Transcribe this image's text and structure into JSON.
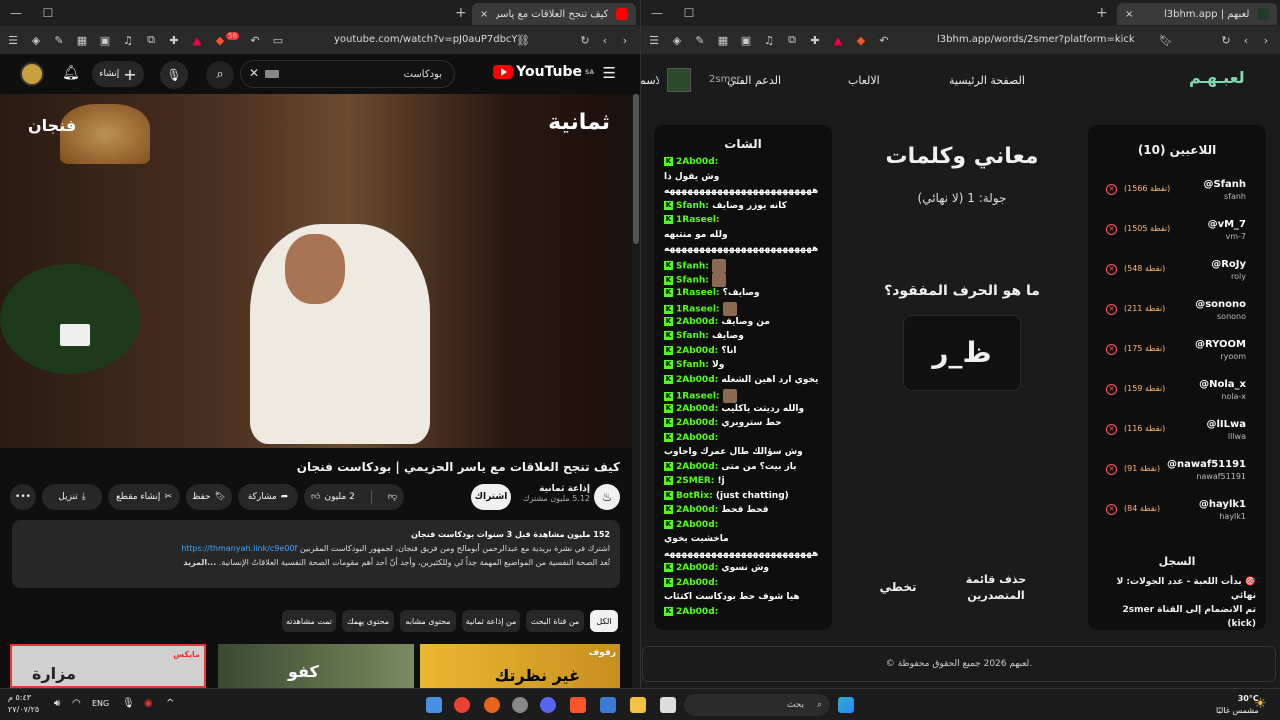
{
  "left_window": {
    "tab": {
      "title": "كيف تنجح العلاقات مع ياسر الحز",
      "close": "×",
      "new": "+"
    },
    "win_controls": {
      "min": "—",
      "max": "☐"
    },
    "url": "youtube.com/watch?v=pJ0auP7dbcY",
    "badge": "56",
    "youtube": {
      "logo": "YouTube",
      "country": "SA",
      "search_value": "بودكاست",
      "create_label": "إنشاء",
      "video_overlay_left": "فنجان",
      "video_overlay_right": "ثمانية",
      "title": "كيف تنجح العلاقات مع ياسر الحزيمي | بودكاست فنجان",
      "channel": "إذاعة ثمانية",
      "subscribers": "5.12 مليون مشترك",
      "subscribe_label": "اشتراك",
      "likes": "2 مليون",
      "share": "مشاركة",
      "save": "حفظ",
      "clip": "إنشاء مقطع",
      "download": "تنزيل",
      "desc_line1": "152 مليون مشاهدة  قبل 3 سنوات  بودكاست فنجان",
      "desc_line2": "اشترك في نشرة بريدية مع عبدالرحمن أبومالح ومن فريق فنجان، لجمهور البودكاست المقربين",
      "desc_link": "https://thmanyah.link/c9e00f",
      "desc_line3": "تُعد الصحة النفسية من المواضيع المهمة جداً لي وللكثيرين، وأجد أنّ أحد أهم مقومات الصحة النفسية العلاقاتُ الإنسانية.",
      "desc_more": "...المزيد",
      "chips": [
        "الكل",
        "من قناة البحث",
        "من إذاعة ثمانية",
        "محتوى مشابه",
        "محتوى يهمك",
        "تمت مشاهدته"
      ],
      "thumb_labels": [
        "رفوف",
        "غير نظرتك",
        "كفو",
        "مزارة",
        "مايكس"
      ]
    }
  },
  "right_window": {
    "tab": {
      "title": "لعبهم | l3bhm.app",
      "close": "×",
      "new": "+"
    },
    "url": "l3bhm.app/words/2smer?platform=kick",
    "site": {
      "logo": "لعبـهـم",
      "nav": [
        "الصفحة الرئيسية",
        "الالعاب",
        "الدعم الفني",
        "الاسم"
      ],
      "user": "2smer",
      "players_title": "اللاعبين (10)",
      "players": [
        {
          "name": "@Sfanh",
          "sub": "sfanh",
          "points": "(1566 نقطة)"
        },
        {
          "name": "@vM_7",
          "sub": "vm-7",
          "points": "(1505 نقطة)"
        },
        {
          "name": "@RoJy",
          "sub": "roly",
          "points": "(548 نقطة)"
        },
        {
          "name": "@sonono",
          "sub": "sonono",
          "points": "(211 نقطة)"
        },
        {
          "name": "@RYOOM",
          "sub": "ryoom",
          "points": "(175 نقطة)"
        },
        {
          "name": "@Nola_x",
          "sub": "nola-x",
          "points": "(159 نقطة)"
        },
        {
          "name": "@lILwa",
          "sub": "lllwa",
          "points": "(116 نقطة)"
        },
        {
          "name": "@nawaf51191",
          "sub": "nawaf51191",
          "points": "(91 نقطة)"
        },
        {
          "name": "@haylk1",
          "sub": "haylk1",
          "points": "(84 نقطة)"
        }
      ],
      "game_title": "معاني وكلمات",
      "round": "جولة: 1 (لا نهائي)",
      "question": "ما هو الحرف المفقود؟",
      "puzzle": "ظ_ر",
      "skip_label": "تخطي",
      "clear_label": "حذف قائمة المتصدرين",
      "log_title": "السجل",
      "log_lines": [
        "🎯 بدأت اللعبة - عدد الجولات: لا نهائي",
        "تم الانضمام إلى القناة 2smer (kick)"
      ],
      "chat_title": "الشات",
      "chat": [
        {
          "user": "2Ab00d:",
          "text": ""
        },
        {
          "user": "",
          "text": "وش يقول ذا"
        },
        {
          "user": "",
          "text": "هههههههههههههههههههههههههه"
        },
        {
          "user": "Sfanh:",
          "text": "كانه يوزر وصايف"
        },
        {
          "user": "1Raseel:",
          "text": ""
        },
        {
          "user": "",
          "text": "ولله مو منتبهه"
        },
        {
          "user": "",
          "text": "هههههههههههههههههههههههههه"
        },
        {
          "user": "Sfanh:",
          "text": "[emote]"
        },
        {
          "user": "Sfanh:",
          "text": "[emote]"
        },
        {
          "user": "1Raseel:",
          "text": "وصايف؟"
        },
        {
          "user": "1Raseel:",
          "text": "[emote]"
        },
        {
          "user": "2Ab00d:",
          "text": "من وصايف"
        },
        {
          "user": "Sfanh:",
          "text": "وصايف"
        },
        {
          "user": "2Ab00d:",
          "text": "انا؟"
        },
        {
          "user": "Sfanh:",
          "text": "ولا"
        },
        {
          "user": "2Ab00d:",
          "text": "يخوي ارد اهين الشغله"
        },
        {
          "user": "1Raseel:",
          "text": "[emote]"
        },
        {
          "user": "2Ab00d:",
          "text": "والله رديتت ياكليب"
        },
        {
          "user": "2Ab00d:",
          "text": "حط ستروبري"
        },
        {
          "user": "2Ab00d:",
          "text": ""
        },
        {
          "user": "",
          "text": "وش سؤالك طال عمرك واجاوب"
        },
        {
          "user": "2Ab00d:",
          "text": "باز بيت؟ من متى"
        },
        {
          "user": "2SMER:",
          "text": "!j"
        },
        {
          "user": "BotRix:",
          "text": "(just chatting)"
        },
        {
          "user": "2Ab00d:",
          "text": "قحط قحط"
        },
        {
          "user": "2Ab00d:",
          "text": ""
        },
        {
          "user": "",
          "text": "ماخشيت يخوي"
        },
        {
          "user": "",
          "text": "هههههههههههههههههههههههههه"
        },
        {
          "user": "2Ab00d:",
          "text": "وش نسوي"
        },
        {
          "user": "2Ab00d:",
          "text": ""
        },
        {
          "user": "",
          "text": "هيا شوف حط بودكاست اكتئاب"
        },
        {
          "user": "2Ab00d:",
          "text": ""
        }
      ],
      "footer": "© لعبهم 2026 جميع الحقوق محفوظة."
    }
  },
  "taskbar": {
    "weather_temp": "30°C",
    "weather_desc": "مشمس غالبًا",
    "search": "بحث",
    "lang": "ENG",
    "time": "٥:٤٣ م",
    "date": "٢٧/٠٧/٢٥"
  }
}
